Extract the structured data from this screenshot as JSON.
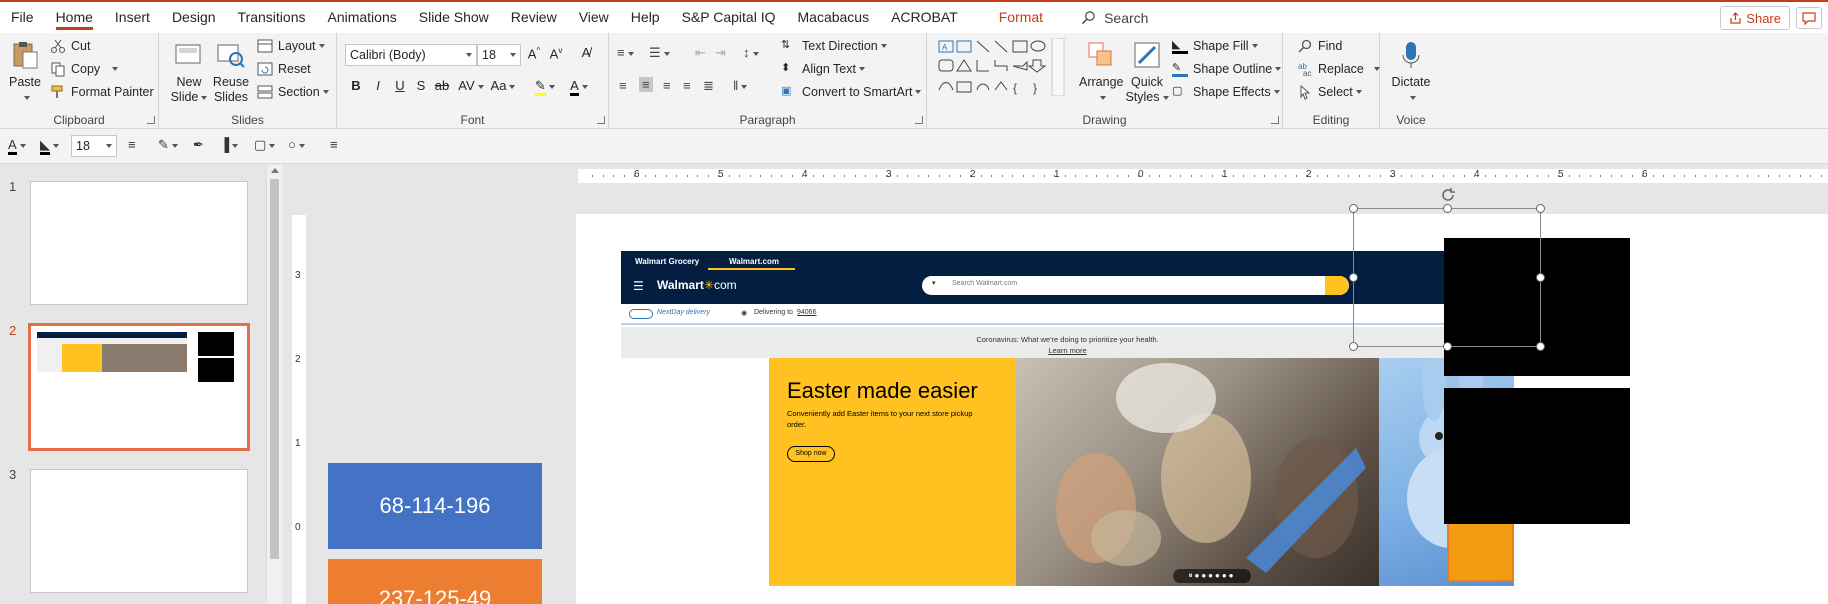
{
  "menubar": {
    "tabs": [
      "File",
      "Home",
      "Insert",
      "Design",
      "Transitions",
      "Animations",
      "Slide Show",
      "Review",
      "View",
      "Help",
      "S&P Capital IQ",
      "Macabacus",
      "ACROBAT",
      "Format"
    ],
    "active_tab": "Home",
    "search_label": "Search",
    "share_label": "Share"
  },
  "ribbon": {
    "clipboard": {
      "label": "Clipboard",
      "paste": "Paste",
      "cut": "Cut",
      "copy": "Copy",
      "format_painter": "Format Painter"
    },
    "slides": {
      "label": "Slides",
      "new_slide_1": "New",
      "new_slide_2": "Slide",
      "reuse_1": "Reuse",
      "reuse_2": "Slides",
      "layout": "Layout",
      "reset": "Reset",
      "section": "Section"
    },
    "font": {
      "label": "Font",
      "font_name": "Calibri (Body)",
      "font_size": "18"
    },
    "paragraph": {
      "label": "Paragraph",
      "text_direction": "Text Direction",
      "align_text": "Align Text",
      "convert_smartart": "Convert to SmartArt"
    },
    "drawing": {
      "label": "Drawing",
      "arrange": "Arrange",
      "quick_styles_1": "Quick",
      "quick_styles_2": "Styles",
      "shape_fill": "Shape Fill",
      "shape_outline": "Shape Outline",
      "shape_effects": "Shape Effects"
    },
    "editing": {
      "label": "Editing",
      "find": "Find",
      "replace": "Replace",
      "select": "Select"
    },
    "voice": {
      "label": "Voice",
      "dictate": "Dictate"
    }
  },
  "qat": {
    "font_size": "18"
  },
  "thumbnails": [
    {
      "num": "1"
    },
    {
      "num": "2"
    },
    {
      "num": "3"
    }
  ],
  "rulers": {
    "h": [
      "6",
      "5",
      "4",
      "3",
      "2",
      "1",
      "0",
      "1",
      "2",
      "3",
      "4",
      "5",
      "6"
    ],
    "v": [
      "3",
      "2",
      "1",
      "0"
    ]
  },
  "slide": {
    "box_blue": {
      "text": "68-114-196",
      "color": "#4472c4"
    },
    "box_orange": {
      "text": "237-125-49",
      "color": "#ed7d31"
    },
    "walmart": {
      "tab_grocery": "Walmart Grocery",
      "tab_walmart": "Walmart.com",
      "logo": "Walmart",
      "logo_suffix": "com",
      "search_placeholder": "Search Walmart.com",
      "nextday": "NextDay delivery",
      "delivering": "Delivering to",
      "zip": "94066",
      "banner": "Coronavirus: What we're doing to prioritize your health.",
      "learn_more": "Learn more",
      "hero_title": "Easter made easier",
      "hero_sub": "Conveniently add Easter items to your next store pickup order.",
      "hero_button": "Shop now"
    }
  }
}
